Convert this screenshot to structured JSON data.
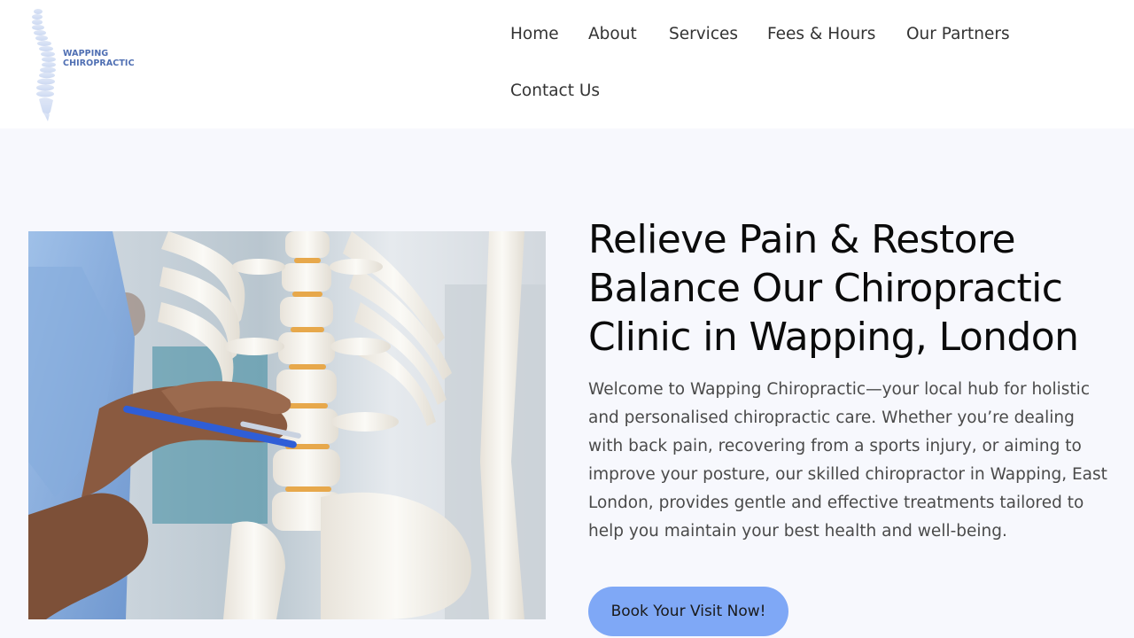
{
  "brand": {
    "name_line1": "WAPPING",
    "name_line2": "CHIROPRACTIC"
  },
  "nav": {
    "items": [
      {
        "label": "Home"
      },
      {
        "label": "About"
      },
      {
        "label": "Services"
      },
      {
        "label": "Fees & Hours"
      },
      {
        "label": "Our Partners"
      },
      {
        "label": "Contact Us"
      }
    ]
  },
  "hero": {
    "title": "Relieve Pain & Restore Balance Our Chiropractic Clinic in Wapping, London",
    "description": "Welcome to Wapping Chiropractic—your local hub for holistic and personalised chiropractic care. Whether you’re dealing with back pain, recovering from a sports injury, or aiming to improve your posture, our skilled chiropractor in Wapping, East London, provides gentle and effective treatments tailored to help you maintain your best health and well-being.",
    "cta_label": "Book Your Visit Now!"
  },
  "colors": {
    "accent": "#7fa8f6",
    "brand_text": "#4f6fb3",
    "hero_background": "#f7f8fd"
  },
  "icons": {
    "logo": "spine-logo-icon",
    "hero_image": "spine-model-photo"
  }
}
